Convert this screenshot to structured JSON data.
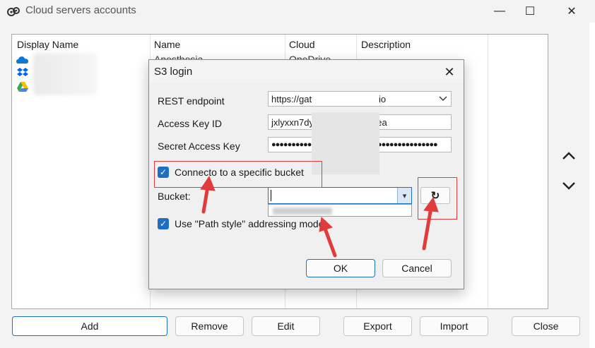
{
  "window": {
    "title": "Cloud servers accounts",
    "minimize_glyph": "—",
    "maximize_glyph": "☐",
    "close_glyph": "✕"
  },
  "accounts_list": {
    "columns": [
      "Display Name",
      "Name",
      "Cloud",
      "Description"
    ],
    "first_row": {
      "name": "Anesthesia",
      "cloud": "OneDrive"
    },
    "row_icons": [
      "onedrive-icon",
      "dropbox-icon",
      "google-drive-icon"
    ]
  },
  "side_buttons": {
    "up_glyph": "▲",
    "down_glyph": "▼"
  },
  "bottom_buttons": {
    "add": "Add",
    "remove": "Remove",
    "edit": "Edit",
    "export": "Export",
    "import": "Import",
    "close": "Close"
  },
  "dialog": {
    "title": "S3 login",
    "close_glyph": "✕",
    "rest_endpoint_label": "REST endpoint",
    "rest_endpoint_value": "https://gat",
    "rest_endpoint_suffix": "io",
    "access_key_label": "Access Key ID",
    "access_key_value": "jxlyxxn7dy",
    "access_key_suffix": "aea",
    "secret_key_label": "Secret Access Key",
    "secret_key_value": "●●●●●●●●●●",
    "secret_key_suffix": "●●●●●●●●●●●●●●●",
    "connect_bucket_label": "Connecto to a specific bucket",
    "connect_bucket_checked": true,
    "bucket_label": "Bucket:",
    "bucket_value": "",
    "bucket_dropdown_glyph": "▾",
    "refresh_glyph": "↻",
    "path_style_label": "Use \"Path style\" addressing model",
    "path_style_checked": true,
    "ok": "OK",
    "cancel": "Cancel",
    "check_glyph": "✓"
  },
  "colors": {
    "accent": "#1d6fc2",
    "annotation_red": "#e23b3b"
  }
}
